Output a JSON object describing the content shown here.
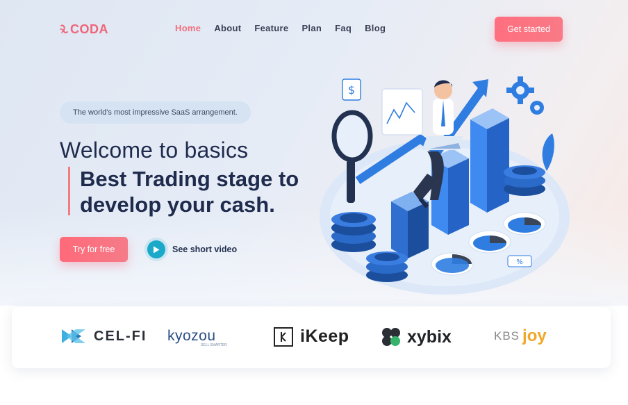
{
  "brand": {
    "name": "CODA",
    "logo_icon": "swirl-icon",
    "color": "#f0657a"
  },
  "nav": {
    "items": [
      {
        "label": "Home",
        "active": true
      },
      {
        "label": "About",
        "active": false
      },
      {
        "label": "Feature",
        "active": false
      },
      {
        "label": "Plan",
        "active": false
      },
      {
        "label": "Faq",
        "active": false
      },
      {
        "label": "Blog",
        "active": false
      }
    ],
    "cta_label": "Get started"
  },
  "hero": {
    "tagline": "The world's most impressive SaaS arrangement.",
    "title_light": "Welcome to basics",
    "title_bold_line1": "Best Trading stage to",
    "title_bold_line2": "develop your cash.",
    "primary_button": "Try for free",
    "video_link": "See short video",
    "video_icon": "play-icon"
  },
  "partners": [
    {
      "name": "CEL-FI",
      "icon": "cel-fi-logo"
    },
    {
      "name": "kyozou",
      "tagline": "SELL SMARTER",
      "icon": "kyozou-logo"
    },
    {
      "name": "iKeep",
      "icon": "ikeep-logo"
    },
    {
      "name": "xybix",
      "icon": "xybix-logo"
    },
    {
      "name": "KBS",
      "suffix": "joy",
      "icon": "kbs-joy-logo"
    }
  ],
  "colors": {
    "accent": "#f0707e",
    "navy": "#1f2b4d",
    "teal": "#1aa9c9",
    "blue": "#2f7de1"
  }
}
